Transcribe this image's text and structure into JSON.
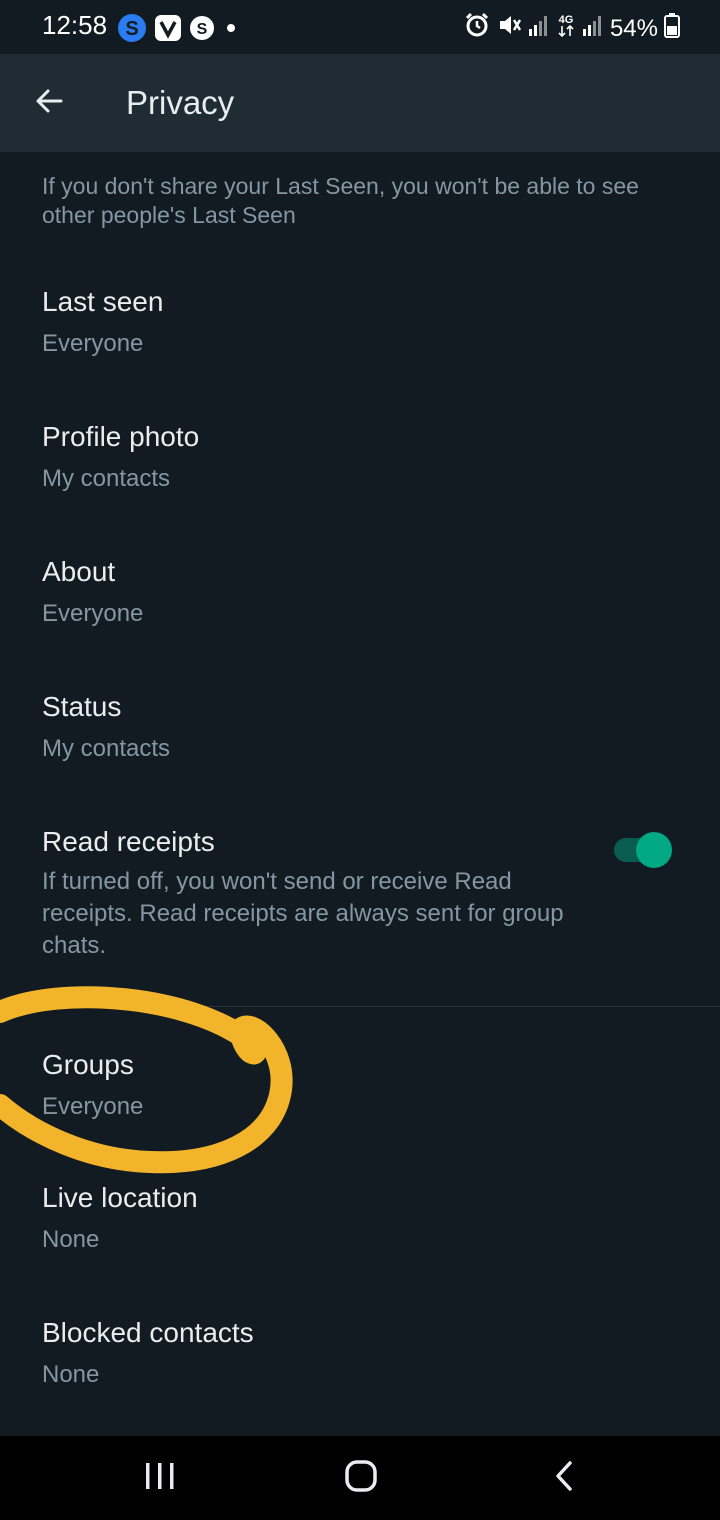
{
  "status_bar": {
    "time": "12:58",
    "battery": "54%",
    "left_icons": [
      "skype-icon",
      "v-app-icon",
      "s-app-icon",
      "dot-icon"
    ],
    "right_icons": [
      "alarm-icon",
      "mute-icon",
      "signal-icon",
      "4g-icon",
      "signal-icon",
      "battery-icon"
    ]
  },
  "app_bar": {
    "title": "Privacy",
    "back_icon": "arrow-left-icon"
  },
  "note": "If you don't share your Last Seen, you won't be able to see other people's Last Seen",
  "settings": {
    "last_seen": {
      "label": "Last seen",
      "value": "Everyone"
    },
    "profile_photo": {
      "label": "Profile photo",
      "value": "My contacts"
    },
    "about": {
      "label": "About",
      "value": "Everyone"
    },
    "status": {
      "label": "Status",
      "value": "My contacts"
    },
    "read_receipts": {
      "label": "Read receipts",
      "description": "If turned off, you won't send or receive Read receipts. Read receipts are always sent for group chats.",
      "enabled": true
    },
    "groups": {
      "label": "Groups",
      "value": "Everyone"
    },
    "live_location": {
      "label": "Live location",
      "value": "None"
    },
    "blocked_contacts": {
      "label": "Blocked contacts",
      "value": "None"
    }
  },
  "annotation": {
    "color": "#f2b42a"
  },
  "colors": {
    "background": "#121b22",
    "app_bar": "#1f2c34",
    "accent": "#00a884",
    "secondary_text": "#8696a0"
  },
  "nav_bar": {
    "icons": [
      "recents-icon",
      "home-icon",
      "back-nav-icon"
    ]
  }
}
